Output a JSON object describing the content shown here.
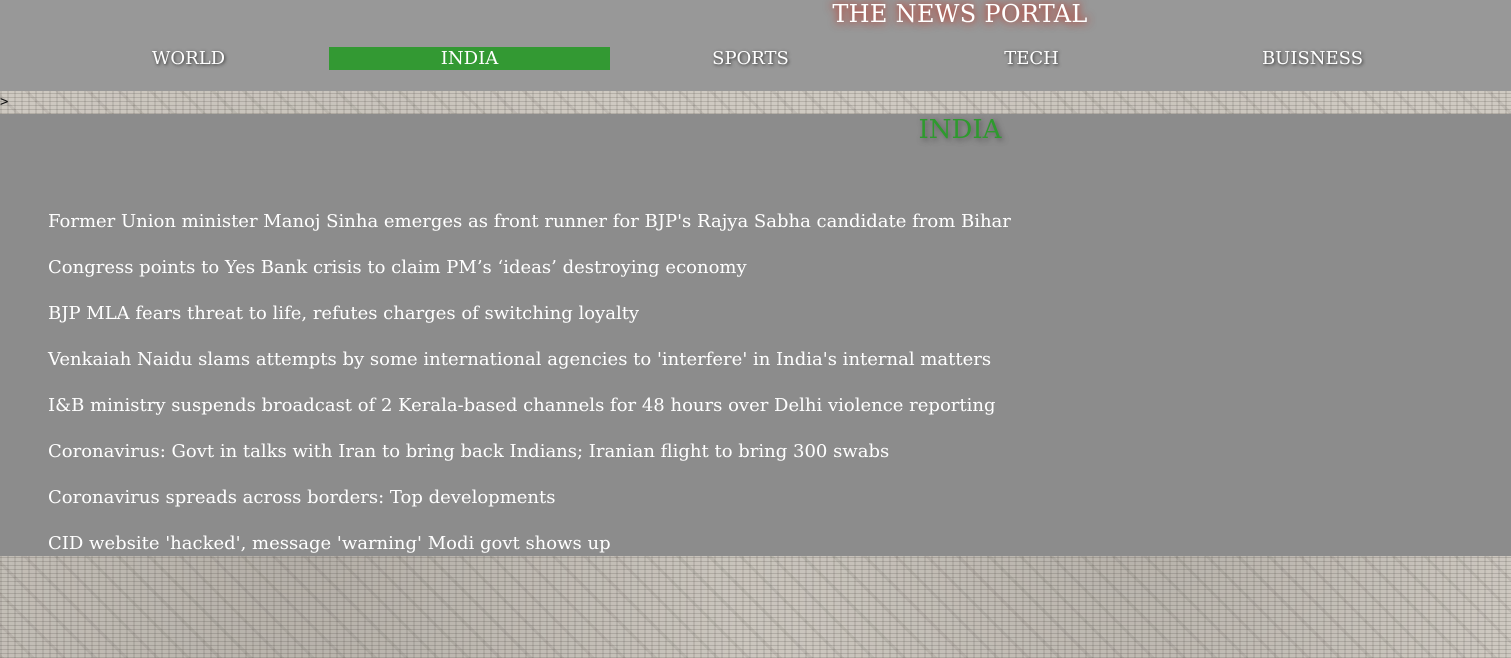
{
  "site": {
    "title": "THE NEWS PORTAL"
  },
  "nav": {
    "items": [
      {
        "label": "WORLD",
        "active": false
      },
      {
        "label": "INDIA",
        "active": true
      },
      {
        "label": "SPORTS",
        "active": false
      },
      {
        "label": "TECH",
        "active": false
      },
      {
        "label": "BUISNESS",
        "active": false
      }
    ]
  },
  "misc": {
    "arrow": ">"
  },
  "section": {
    "title": "INDIA",
    "headlines": [
      "Former Union minister Manoj Sinha emerges as front runner for BJP's Rajya Sabha candidate from Bihar",
      "Congress points to Yes Bank crisis to claim PM’s ‘ideas’ destroying economy",
      "BJP MLA fears threat to life, refutes charges of switching loyalty",
      "Venkaiah Naidu slams attempts by some international agencies to 'interfere' in India's internal matters",
      "I&B ministry suspends broadcast of 2 Kerala-based channels for 48 hours over Delhi violence reporting",
      "Coronavirus: Govt in talks with Iran to bring back Indians; Iranian flight to bring 300 swabs",
      "Coronavirus spreads across borders: Top developments",
      "CID website 'hacked', message 'warning' Modi govt shows up"
    ]
  },
  "colors": {
    "header_bg": "#989898",
    "content_bg": "#8c8c8c",
    "active_nav_bg": "#339933",
    "section_title": "#2e9a2e",
    "title_glow": "#c0392b"
  }
}
